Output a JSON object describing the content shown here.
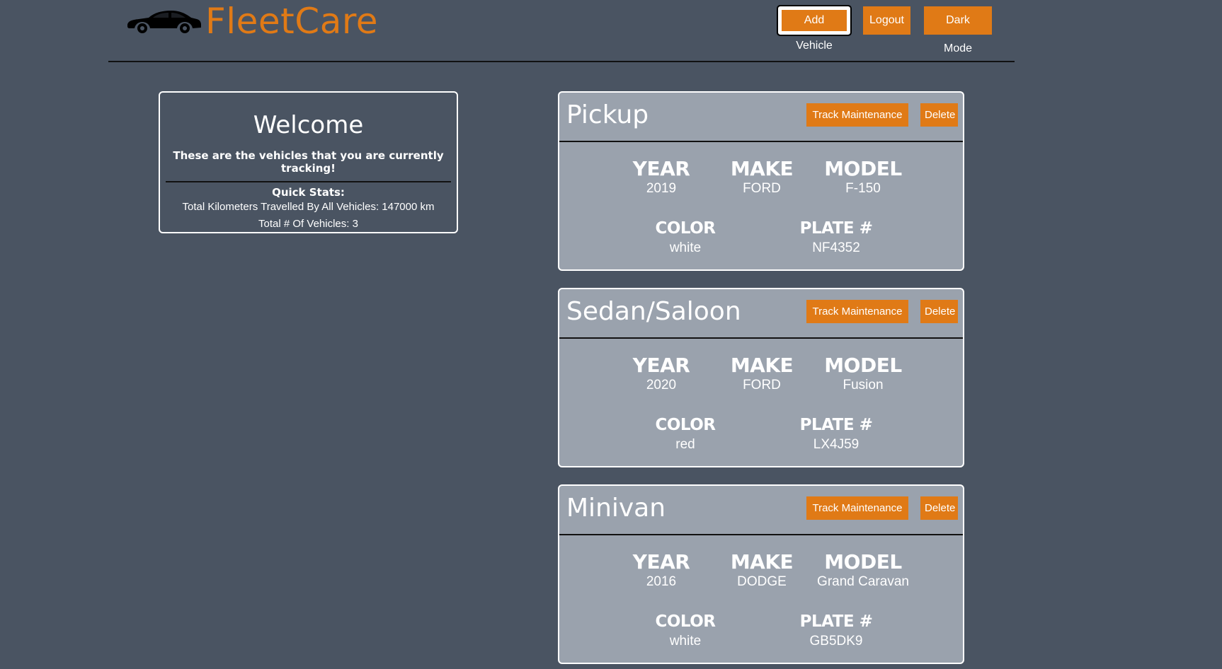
{
  "header": {
    "brand": "FleetCare",
    "buttons": {
      "add_vehicle": "Add Vehicle",
      "logout": "Logout",
      "dark_mode": "Dark Mode"
    }
  },
  "welcome": {
    "title": "Welcome",
    "subtitle": "These are the vehicles that you are currently tracking!",
    "quick_stats_title": "Quick Stats:",
    "km_line": "Total Kilometers Travelled By All Vehicles:  147000 km",
    "count_line": "Total # Of Vehicles:  3"
  },
  "labels": {
    "year": "YEAR",
    "make": "MAKE",
    "model": "MODEL",
    "color": "COLOR",
    "plate": "PLATE #",
    "track": "Track Maintenance",
    "delete": "Delete"
  },
  "vehicles": [
    {
      "type": "Pickup",
      "year": "2019",
      "make": "FORD",
      "model": "F-150",
      "color": "white",
      "plate": "NF4352"
    },
    {
      "type": "Sedan/Saloon",
      "year": "2020",
      "make": "FORD",
      "model": "Fusion",
      "color": "red",
      "plate": "LX4J59"
    },
    {
      "type": "Minivan",
      "year": "2016",
      "make": "DODGE",
      "model": "Grand Caravan",
      "color": "white",
      "plate": "GB5DK9"
    }
  ],
  "colors": {
    "background": "#4a5462",
    "accent": "#e07a16",
    "card": "#9aa2ad"
  },
  "icons": {
    "logo": "car-icon"
  }
}
